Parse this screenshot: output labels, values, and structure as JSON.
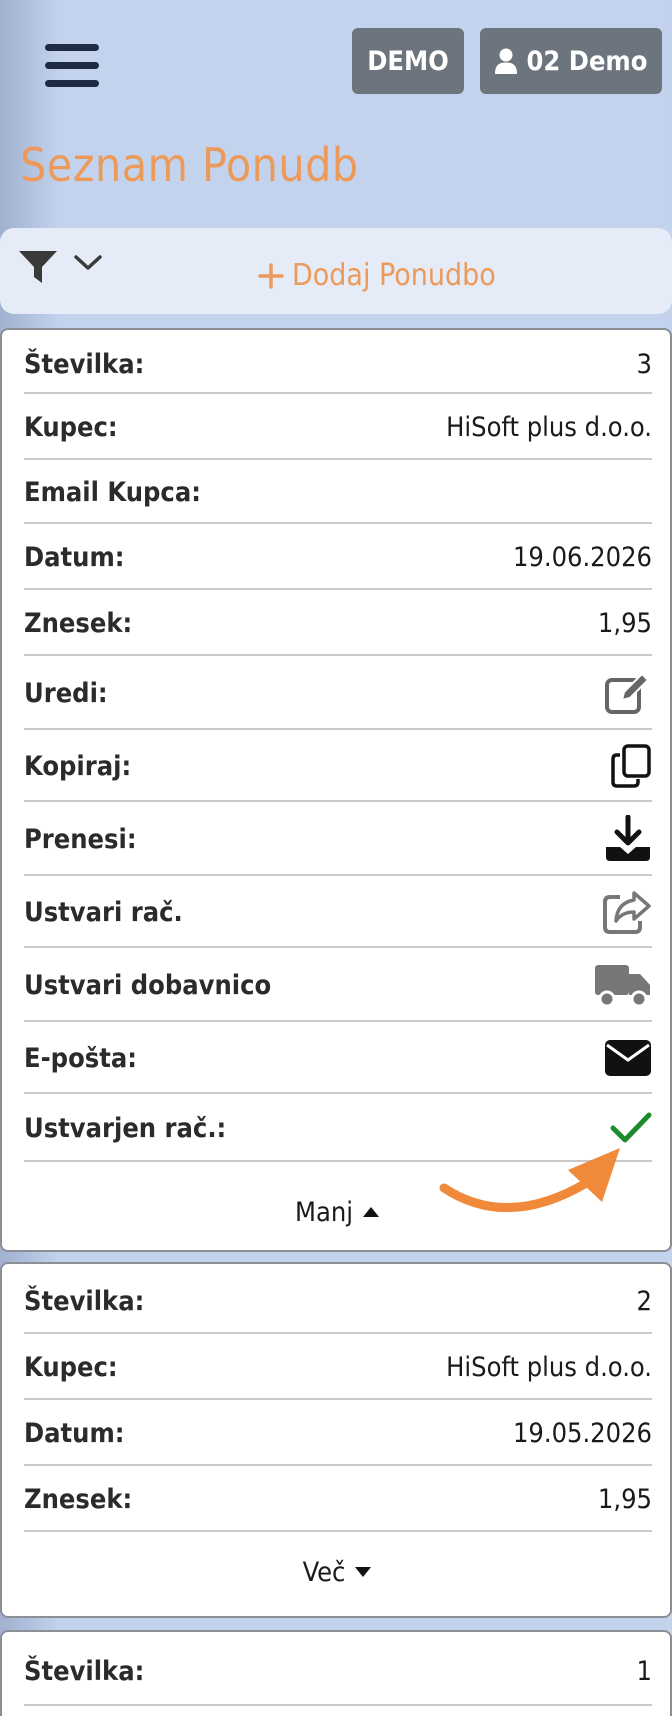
{
  "header": {
    "demo_label": "DEMO",
    "user_label": "02 Demo"
  },
  "page": {
    "title": "Seznam Ponudb",
    "add_label": "Dodaj Ponudbo"
  },
  "cards": [
    {
      "stevilka_label": "Številka:",
      "stevilka": "3",
      "kupec_label": "Kupec:",
      "kupec": "HiSoft plus d.o.o.",
      "email_label": "Email Kupca:",
      "email": "",
      "datum_label": "Datum:",
      "datum": "19.06.2026",
      "znesek_label": "Znesek:",
      "znesek": "1,95",
      "uredi_label": "Uredi:",
      "kopiraj_label": "Kopiraj:",
      "prenesi_label": "Prenesi:",
      "ustvari_rac_label": "Ustvari rač.",
      "ustvari_dob_label": "Ustvari dobavnico",
      "eposta_label": "E-pošta:",
      "ustvarjen_label": "Ustvarjen rač.:",
      "toggle_label": "Manj"
    },
    {
      "stevilka_label": "Številka:",
      "stevilka": "2",
      "kupec_label": "Kupec:",
      "kupec": "HiSoft plus d.o.o.",
      "datum_label": "Datum:",
      "datum": "19.05.2026",
      "znesek_label": "Znesek:",
      "znesek": "1,95",
      "toggle_label": "Več"
    },
    {
      "stevilka_label": "Številka:",
      "stevilka": "1"
    }
  ],
  "colors": {
    "accent": "#ec9a5a",
    "button_gray": "#6c757d",
    "check_green": "#1e8a2e",
    "background": "#c3d3ee"
  },
  "icons": {
    "menu": "hamburger-icon",
    "user": "user-icon",
    "filter": "filter-icon",
    "edit": "edit-icon",
    "copy": "copy-icon",
    "download": "download-icon",
    "share": "share-icon",
    "truck": "truck-icon",
    "email": "envelope-icon",
    "check": "check-icon"
  }
}
